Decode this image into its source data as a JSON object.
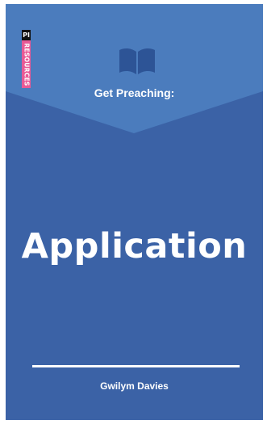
{
  "cover": {
    "publisher_logo": {
      "mark": "PI",
      "wordmark": "RESOURCES",
      "colors": {
        "mark": "#111111",
        "wordmark_bg": "#e85a96"
      }
    },
    "series_title": "Get Preaching:",
    "title": "Application",
    "author": "Gwilym Davies",
    "icon": "open-book-icon",
    "colors": {
      "background": "#3b62a6",
      "chevron": "#4b7cbd",
      "icon": "#2d5496",
      "text": "#ffffff"
    }
  }
}
